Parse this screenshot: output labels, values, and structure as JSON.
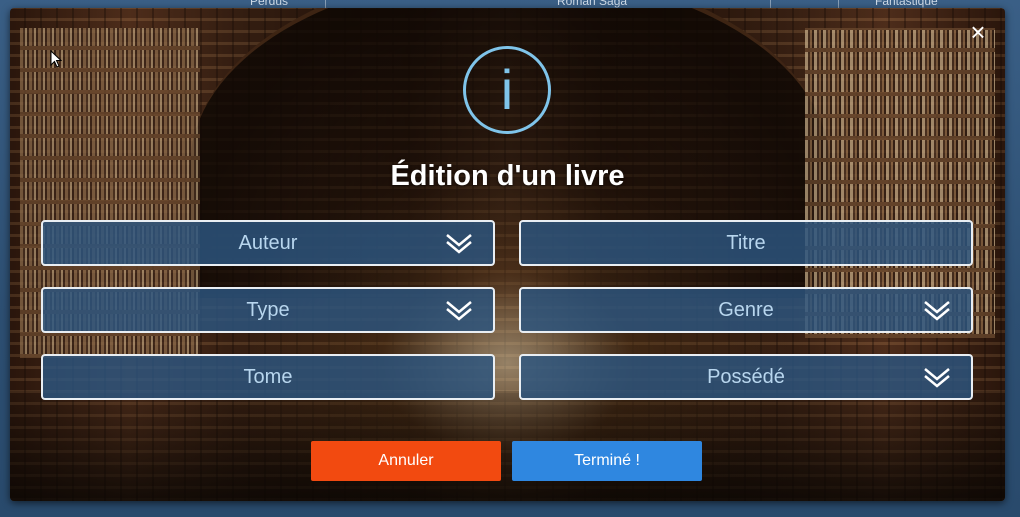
{
  "background": {
    "header_cells": [
      "Perdus",
      "Roman Saga",
      "Fantastique"
    ]
  },
  "modal": {
    "title": "Édition d'un livre",
    "close_glyph": "×",
    "info_glyph": "i",
    "icons": [
      "close-icon",
      "info-icon",
      "chevron-down-icon"
    ],
    "fields": {
      "auteur": "Auteur",
      "titre": "Titre",
      "type": "Type",
      "genre": "Genre",
      "tome": "Tome",
      "possede": "Possédé"
    },
    "buttons": {
      "cancel": "Annuler",
      "done": "Terminé !"
    },
    "colors": {
      "cancel": "#f24a10",
      "done": "#2f87e0",
      "info": "#7fc4ea",
      "field_bg": "#2c5680"
    }
  }
}
